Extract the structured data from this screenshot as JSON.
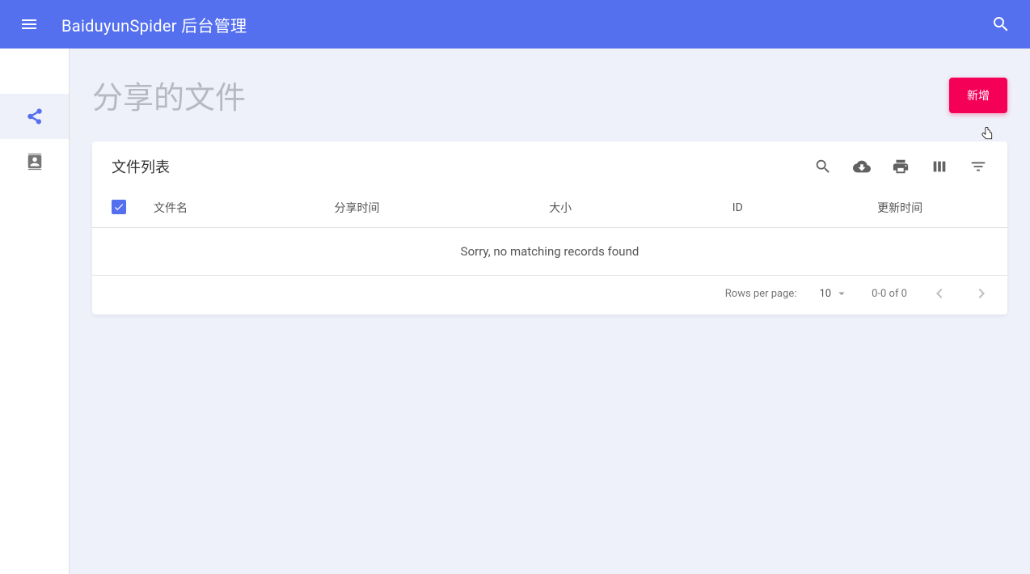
{
  "appbar": {
    "title": "BaiduyunSpider 后台管理"
  },
  "sidebar": {
    "items": [
      {
        "name": "share-icon"
      },
      {
        "name": "contact-icon"
      }
    ]
  },
  "page": {
    "title": "分享的文件",
    "add_button": "新增"
  },
  "card": {
    "title": "文件列表",
    "columns": {
      "col0": "",
      "col1": "文件名",
      "col2": "分享时间",
      "col3": "大小",
      "col4": "ID",
      "col5": "更新时间"
    },
    "empty_message": "Sorry, no matching records found",
    "footer": {
      "rows_label": "Rows per page:",
      "rows_value": "10",
      "range": "0-0 of 0"
    }
  }
}
